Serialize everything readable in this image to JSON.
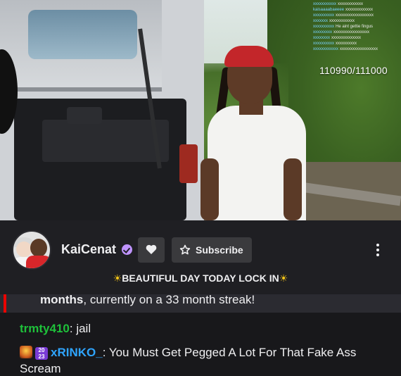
{
  "stream_overlay": {
    "chat_lines": [
      {
        "name": "xxxxxxxxxxx",
        "text": "xxxxxxxxxxxx"
      },
      {
        "name": "kaisaaaabaeeee",
        "text": "xxxxxxxxxxxxx"
      },
      {
        "name": "xxxxxxxxxx",
        "text": "xxxxxxxxxxxxxxxxxx"
      },
      {
        "name": "xxxxxxx",
        "text": "xxxxxxxxxxxx"
      },
      {
        "name": "xxxxxxxxxx",
        "text": "He aint gettie fingus"
      },
      {
        "name": "xxxxxxxxx",
        "text": "xxxxxxxxxxxxxxxxx"
      },
      {
        "name": "xxxxxxxx",
        "text": "xxxxxxxxxxxxxx"
      },
      {
        "name": "xxxxxxxxxx",
        "text": "xxxxxxxxxx"
      },
      {
        "name": "xxxxxxxxxxxx",
        "text": "xxxxxxxxxxxxxxxxxx"
      }
    ],
    "counter": "110990/111000"
  },
  "channel": {
    "name": "KaiCenat",
    "subscribe_label": "Subscribe",
    "stream_title": "BEAUTIFUL DAY TODAY LOCK IN",
    "title_emoji": "☀"
  },
  "chat": {
    "highlight": {
      "bold_part": "months",
      "rest": ", currently on a 33 month streak!"
    },
    "messages": [
      {
        "user": "trmty410",
        "text": "jail"
      },
      {
        "user": "xRINKO_",
        "text": "You Must Get Pegged A Lot For That Fake Ass Scream",
        "badge_text": "20\n23"
      }
    ]
  },
  "colors": {
    "background": "#18181b",
    "channel_bar": "#1f1f23",
    "button": "#3a3a3d",
    "verified": "#bf94ff",
    "highlight_bar": "#eb0400",
    "user_green": "#1ec13a",
    "user_blue": "#2fa5ff"
  },
  "icons": [
    "verified-icon",
    "heart-icon",
    "star-icon",
    "more-options-icon"
  ]
}
